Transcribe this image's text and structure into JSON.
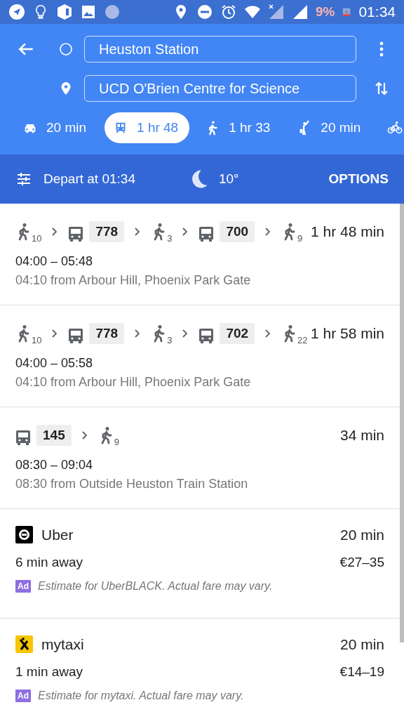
{
  "status_bar": {
    "battery": "9%",
    "time": "01:34"
  },
  "search": {
    "origin": "Heuston Station",
    "destination": "UCD O'Brien Centre for Science"
  },
  "modes": [
    {
      "kind": "car",
      "label": "20 min",
      "selected": false
    },
    {
      "kind": "transit",
      "label": "1 hr 48",
      "selected": true
    },
    {
      "kind": "walk",
      "label": "1 hr 33",
      "selected": false
    },
    {
      "kind": "rideshare",
      "label": "20 min",
      "selected": false
    },
    {
      "kind": "bike",
      "selected": false
    }
  ],
  "options_bar": {
    "depart": "Depart at 01:34",
    "temperature": "10°",
    "options": "OPTIONS"
  },
  "routes": [
    {
      "steps": [
        {
          "kind": "walk",
          "minutes": "10"
        },
        {
          "kind": "bus",
          "line": "778"
        },
        {
          "kind": "walk",
          "minutes": "3"
        },
        {
          "kind": "bus",
          "line": "700"
        },
        {
          "kind": "walk",
          "minutes": "9"
        }
      ],
      "duration": "1 hr 48 min",
      "times": "04:00 – 05:48",
      "from": "04:10 from Arbour Hill, Phoenix Park Gate"
    },
    {
      "steps": [
        {
          "kind": "walk",
          "minutes": "10"
        },
        {
          "kind": "bus",
          "line": "778"
        },
        {
          "kind": "walk",
          "minutes": "3"
        },
        {
          "kind": "bus",
          "line": "702"
        },
        {
          "kind": "walk",
          "minutes": "22"
        }
      ],
      "duration": "1 hr 58 min",
      "times": "04:00 – 05:58",
      "from": "04:10 from Arbour Hill, Phoenix Park Gate"
    },
    {
      "steps": [
        {
          "kind": "bus",
          "line": "145"
        },
        {
          "kind": "walk",
          "minutes": "9"
        }
      ],
      "duration": "34 min",
      "times": "08:30 – 09:04",
      "from": "08:30 from Outside Heuston Train Station"
    }
  ],
  "ride_services": [
    {
      "kind": "uber",
      "name": "Uber",
      "duration": "20 min",
      "eta": "6 min away",
      "price": "€27–35",
      "ad": "Ad",
      "note": "Estimate for UberBLACK. Actual fare may vary."
    },
    {
      "kind": "mytaxi",
      "name": "mytaxi",
      "duration": "20 min",
      "eta": "1 min away",
      "price": "€14–19",
      "ad": "Ad",
      "note": "Estimate for mytaxi. Actual fare may vary."
    }
  ]
}
